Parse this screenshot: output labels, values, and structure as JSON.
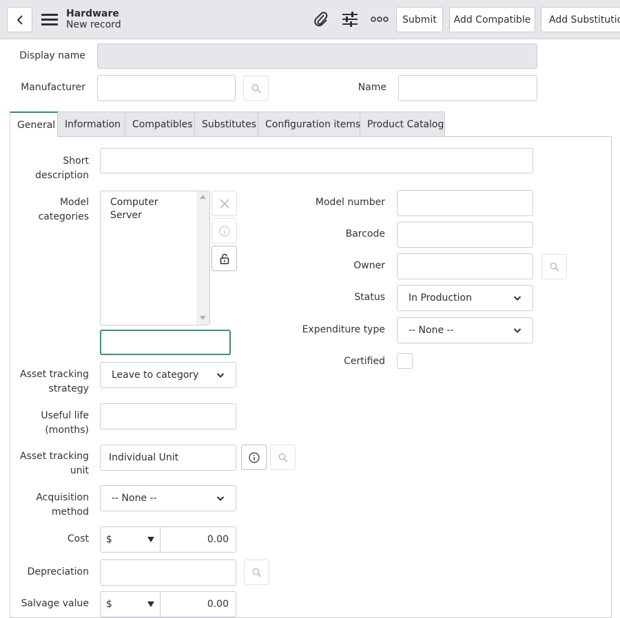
{
  "header": {
    "title": "Hardware",
    "subtitle": "New record",
    "buttons": {
      "submit": "Submit",
      "add_compatible": "Add Compatible",
      "add_substitution": "Add Substitution"
    }
  },
  "form": {
    "display_name": {
      "label": "Display name",
      "value": ""
    },
    "manufacturer": {
      "label": "Manufacturer",
      "value": ""
    },
    "name": {
      "label": "Name",
      "value": ""
    }
  },
  "tabs": [
    "General",
    "Information",
    "Compatibles",
    "Substitutes",
    "Configuration items",
    "Product Catalog"
  ],
  "general": {
    "short_description": {
      "label_line1": "Short",
      "label_line2": "description",
      "value": ""
    },
    "model_categories": {
      "label": "Model categories",
      "items": [
        "Computer",
        "Server"
      ],
      "search_value": ""
    },
    "model_number": {
      "label": "Model number",
      "value": ""
    },
    "barcode": {
      "label": "Barcode",
      "value": ""
    },
    "owner": {
      "label": "Owner",
      "value": ""
    },
    "status": {
      "label": "Status",
      "value": "In Production"
    },
    "expenditure_type": {
      "label": "Expenditure type",
      "value": "-- None --"
    },
    "certified": {
      "label": "Certified",
      "checked": false
    },
    "asset_tracking_strategy": {
      "label_line1": "Asset tracking",
      "label_line2": "strategy",
      "value": "Leave to category"
    },
    "useful_life": {
      "label_line1": "Useful life",
      "label_line2": "(months)",
      "value": ""
    },
    "asset_tracking_unit": {
      "label_line1": "Asset tracking",
      "label_line2": "unit",
      "value": "Individual Unit"
    },
    "acquisition_method": {
      "label_line1": "Acquisition",
      "label_line2": "method",
      "value": "-- None --"
    },
    "cost": {
      "label": "Cost",
      "currency": "$",
      "amount": "0.00"
    },
    "depreciation": {
      "label": "Depreciation",
      "value": ""
    },
    "salvage_value": {
      "label": "Salvage value",
      "currency": "$",
      "amount": "0.00"
    }
  }
}
